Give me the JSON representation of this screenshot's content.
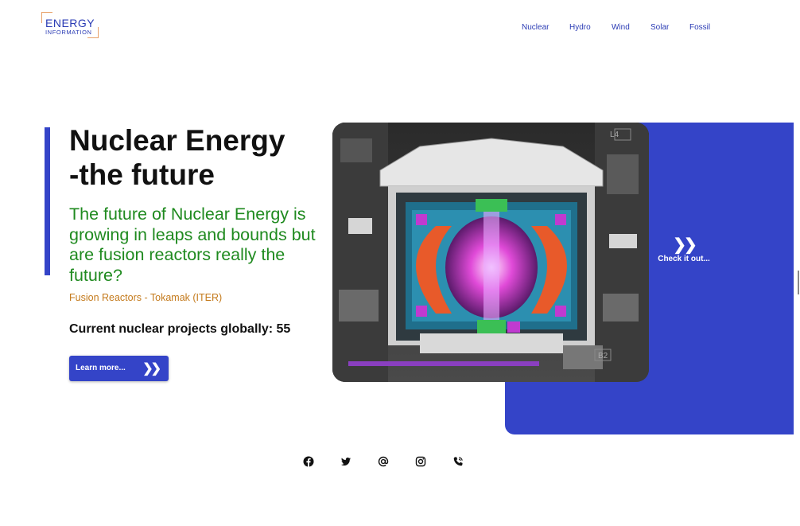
{
  "logo": {
    "line1": "ENERGY",
    "line2": "INFORMATION",
    "accent_color": "#e8a26a",
    "brand_color": "#2a3bb4"
  },
  "nav": {
    "items": [
      {
        "label": "Nuclear"
      },
      {
        "label": "Hydro"
      },
      {
        "label": "Wind"
      },
      {
        "label": "Solar"
      },
      {
        "label": "Fossil"
      }
    ]
  },
  "hero": {
    "title_line1": "Nuclear Energy",
    "title_line2": "-the future",
    "subtitle": "The future of Nuclear Energy is growing in leaps and bounds but are fusion reactors really the future?",
    "caption": "Fusion Reactors - Tokamak (ITER)",
    "projects_text": "Current nuclear projects globally: 55",
    "learn_more_label": "Learn more...",
    "learn_more_icon": "double-chevron-right-icon",
    "check_label": "Check it out...",
    "check_icon": "double-chevron-right-icon",
    "image_labels": {
      "top": "L4",
      "bottom": "B2"
    }
  },
  "social": {
    "icons": [
      "facebook-icon",
      "twitter-icon",
      "at-sign-icon",
      "instagram-icon",
      "phone-icon"
    ]
  },
  "colors": {
    "primary_blue": "#3444c8",
    "subtitle_green": "#1f8a1f",
    "caption_orange": "#c47a1c"
  }
}
